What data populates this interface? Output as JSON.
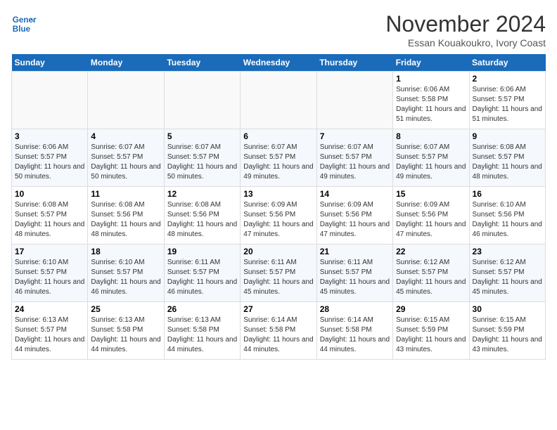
{
  "header": {
    "logo_line1": "General",
    "logo_line2": "Blue",
    "month": "November 2024",
    "location": "Essan Kouakoukro, Ivory Coast"
  },
  "days_of_week": [
    "Sunday",
    "Monday",
    "Tuesday",
    "Wednesday",
    "Thursday",
    "Friday",
    "Saturday"
  ],
  "weeks": [
    [
      {
        "day": "",
        "info": ""
      },
      {
        "day": "",
        "info": ""
      },
      {
        "day": "",
        "info": ""
      },
      {
        "day": "",
        "info": ""
      },
      {
        "day": "",
        "info": ""
      },
      {
        "day": "1",
        "info": "Sunrise: 6:06 AM\nSunset: 5:58 PM\nDaylight: 11 hours and 51 minutes."
      },
      {
        "day": "2",
        "info": "Sunrise: 6:06 AM\nSunset: 5:57 PM\nDaylight: 11 hours and 51 minutes."
      }
    ],
    [
      {
        "day": "3",
        "info": "Sunrise: 6:06 AM\nSunset: 5:57 PM\nDaylight: 11 hours and 50 minutes."
      },
      {
        "day": "4",
        "info": "Sunrise: 6:07 AM\nSunset: 5:57 PM\nDaylight: 11 hours and 50 minutes."
      },
      {
        "day": "5",
        "info": "Sunrise: 6:07 AM\nSunset: 5:57 PM\nDaylight: 11 hours and 50 minutes."
      },
      {
        "day": "6",
        "info": "Sunrise: 6:07 AM\nSunset: 5:57 PM\nDaylight: 11 hours and 49 minutes."
      },
      {
        "day": "7",
        "info": "Sunrise: 6:07 AM\nSunset: 5:57 PM\nDaylight: 11 hours and 49 minutes."
      },
      {
        "day": "8",
        "info": "Sunrise: 6:07 AM\nSunset: 5:57 PM\nDaylight: 11 hours and 49 minutes."
      },
      {
        "day": "9",
        "info": "Sunrise: 6:08 AM\nSunset: 5:57 PM\nDaylight: 11 hours and 48 minutes."
      }
    ],
    [
      {
        "day": "10",
        "info": "Sunrise: 6:08 AM\nSunset: 5:57 PM\nDaylight: 11 hours and 48 minutes."
      },
      {
        "day": "11",
        "info": "Sunrise: 6:08 AM\nSunset: 5:56 PM\nDaylight: 11 hours and 48 minutes."
      },
      {
        "day": "12",
        "info": "Sunrise: 6:08 AM\nSunset: 5:56 PM\nDaylight: 11 hours and 48 minutes."
      },
      {
        "day": "13",
        "info": "Sunrise: 6:09 AM\nSunset: 5:56 PM\nDaylight: 11 hours and 47 minutes."
      },
      {
        "day": "14",
        "info": "Sunrise: 6:09 AM\nSunset: 5:56 PM\nDaylight: 11 hours and 47 minutes."
      },
      {
        "day": "15",
        "info": "Sunrise: 6:09 AM\nSunset: 5:56 PM\nDaylight: 11 hours and 47 minutes."
      },
      {
        "day": "16",
        "info": "Sunrise: 6:10 AM\nSunset: 5:56 PM\nDaylight: 11 hours and 46 minutes."
      }
    ],
    [
      {
        "day": "17",
        "info": "Sunrise: 6:10 AM\nSunset: 5:57 PM\nDaylight: 11 hours and 46 minutes."
      },
      {
        "day": "18",
        "info": "Sunrise: 6:10 AM\nSunset: 5:57 PM\nDaylight: 11 hours and 46 minutes."
      },
      {
        "day": "19",
        "info": "Sunrise: 6:11 AM\nSunset: 5:57 PM\nDaylight: 11 hours and 46 minutes."
      },
      {
        "day": "20",
        "info": "Sunrise: 6:11 AM\nSunset: 5:57 PM\nDaylight: 11 hours and 45 minutes."
      },
      {
        "day": "21",
        "info": "Sunrise: 6:11 AM\nSunset: 5:57 PM\nDaylight: 11 hours and 45 minutes."
      },
      {
        "day": "22",
        "info": "Sunrise: 6:12 AM\nSunset: 5:57 PM\nDaylight: 11 hours and 45 minutes."
      },
      {
        "day": "23",
        "info": "Sunrise: 6:12 AM\nSunset: 5:57 PM\nDaylight: 11 hours and 45 minutes."
      }
    ],
    [
      {
        "day": "24",
        "info": "Sunrise: 6:13 AM\nSunset: 5:57 PM\nDaylight: 11 hours and 44 minutes."
      },
      {
        "day": "25",
        "info": "Sunrise: 6:13 AM\nSunset: 5:58 PM\nDaylight: 11 hours and 44 minutes."
      },
      {
        "day": "26",
        "info": "Sunrise: 6:13 AM\nSunset: 5:58 PM\nDaylight: 11 hours and 44 minutes."
      },
      {
        "day": "27",
        "info": "Sunrise: 6:14 AM\nSunset: 5:58 PM\nDaylight: 11 hours and 44 minutes."
      },
      {
        "day": "28",
        "info": "Sunrise: 6:14 AM\nSunset: 5:58 PM\nDaylight: 11 hours and 44 minutes."
      },
      {
        "day": "29",
        "info": "Sunrise: 6:15 AM\nSunset: 5:59 PM\nDaylight: 11 hours and 43 minutes."
      },
      {
        "day": "30",
        "info": "Sunrise: 6:15 AM\nSunset: 5:59 PM\nDaylight: 11 hours and 43 minutes."
      }
    ]
  ]
}
